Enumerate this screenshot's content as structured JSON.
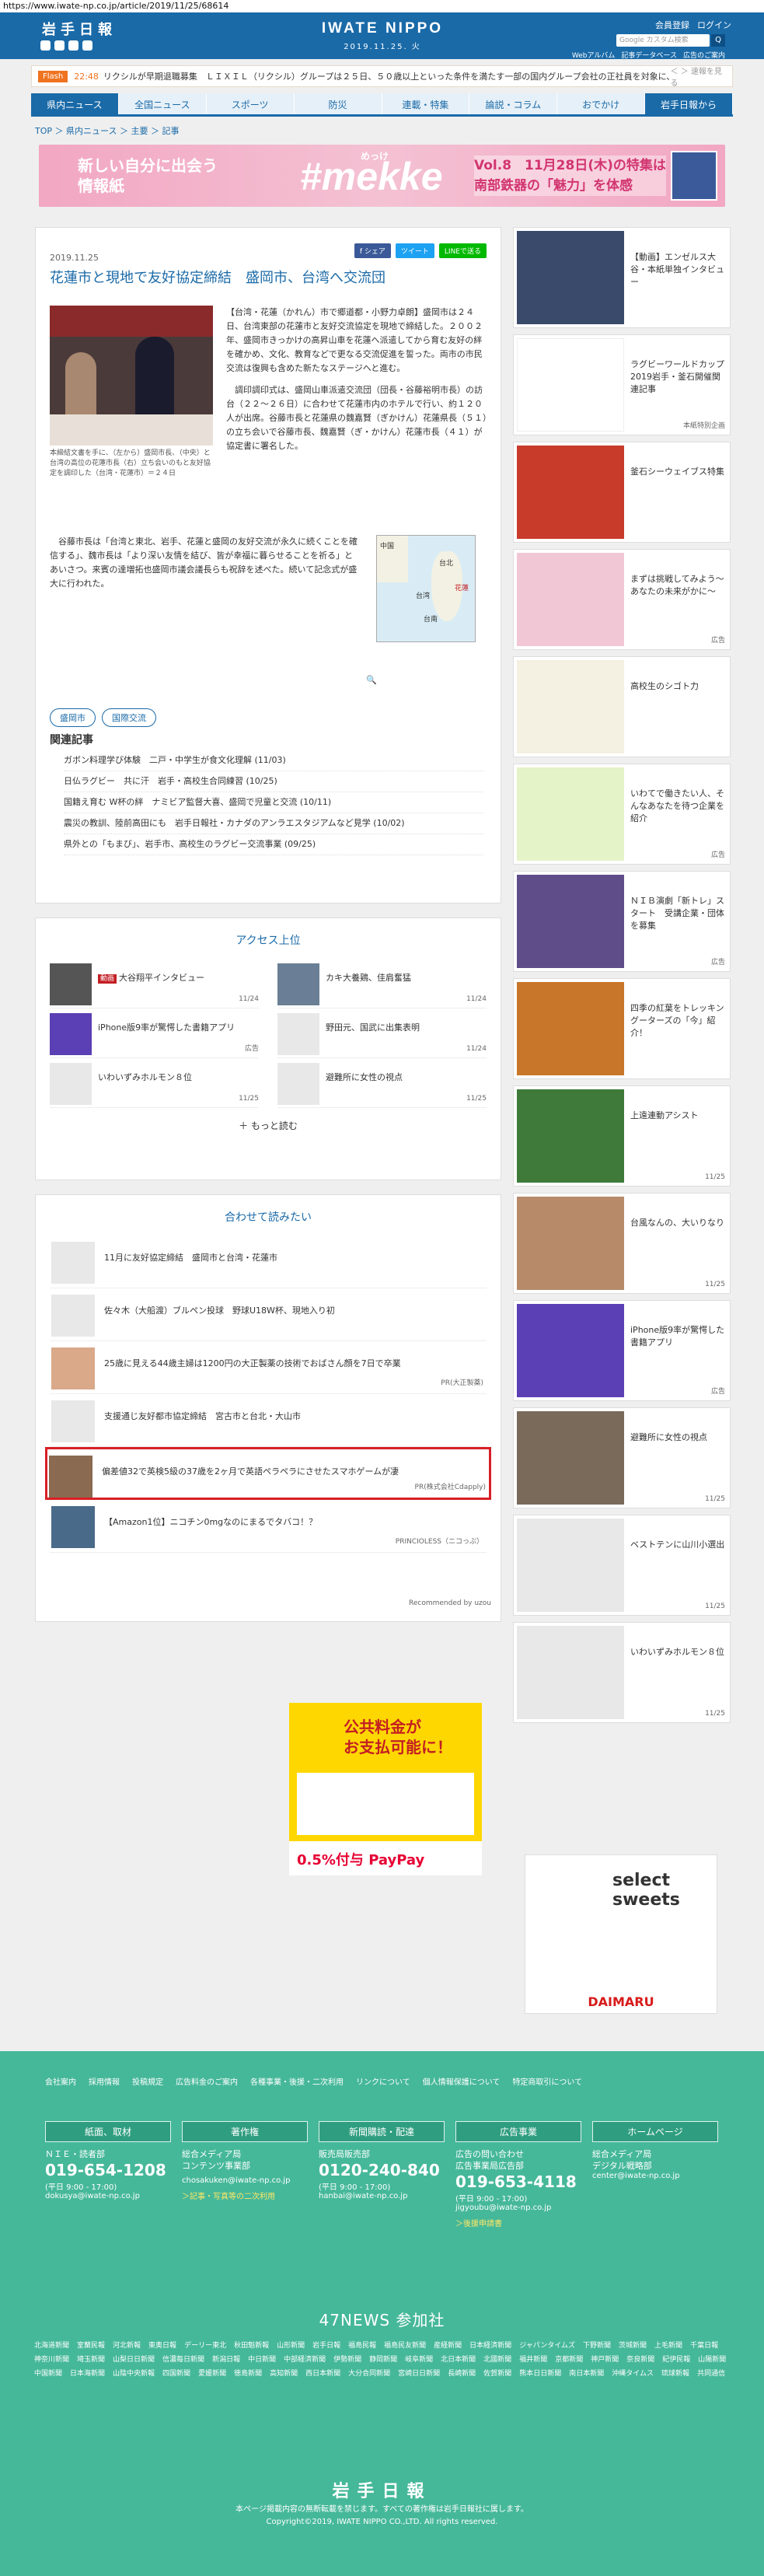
{
  "url": "https://www.iwate-np.co.jp/article/2019/11/25/68614",
  "header": {
    "logo": "岩手日報",
    "brand": "IWATE NIPPO",
    "date": "2019.11.25. 火",
    "member_register": "会員登録",
    "login": "ログイン",
    "search_placeholder": "Google カスタム検索",
    "search_btn": "Q",
    "links": [
      "Webアルバム",
      "記事データベース",
      "広告のご案内"
    ]
  },
  "flash": {
    "tag": "Flash",
    "time": "22:48",
    "text": "リクシルが早期退職募集　ＬＩＸＩＬ（リクシル）グループは２５日、５０歳以上といった条件を満たす一部の国内グループ会社の正社員を対象に、早期退職",
    "ctrl": "＜ ＞ 速報を見る"
  },
  "nav": [
    "県内ニュース",
    "全国ニュース",
    "スポーツ",
    "防災",
    "連載・特集",
    "論説・コラム",
    "おでかけ",
    "岩手日報から"
  ],
  "breadcrumb": "TOP ＞ 県内ニュース ＞ 主要 ＞ 記事",
  "banner": {
    "line1": "新しい自分に出会う",
    "line2": "情報紙",
    "mark": "#mekke",
    "mark_ruby": "めっけ",
    "vol": "Vol.8　11月28日(木)の特集は",
    "feature": "南部鉄器の「魅力」を体感"
  },
  "article": {
    "date": "2019.11.25",
    "title": "花蓮市と現地で友好協定締結　盛岡市、台湾へ交流団",
    "shares": [
      "f シェア",
      "ツイート",
      "LINEで送る"
    ],
    "caption": "本締結文書を手に、（左から）盛岡市長、（中央）と台湾の高位の花蓮市長（右）立ち会いのもと友好協定を調印した（台湾・花蓮市）＝２４日",
    "body1": "【台湾・花蓮（かれん）市で郷道都・小野力卓朗】盛岡市は２４日、台湾東部の花蓮市と友好交流協定を現地で締結した。２００２年、盛岡市きっかけの高昇山車を花蓮へ派遣してから育む友好の絆を確かめ、文化、教育などで更なる交流促進を誓った。両市の市民交流は復興も含めた新たなステージへと進む。",
    "body1b": "　調印調印式は、盛岡山車派遣交流団（団長・谷藤裕明市長）の訪台（２２～２６日）に合わせて花蓮市内のホテルで行い、約１２０人が出席。谷藤市長と花蓮県の魏嘉賢（ぎかけん）花蓮県長（５１）の立ち会いで谷藤市長、魏嘉賢（ぎ・かけん）花蓮市長（４１）が協定書に署名した。",
    "body2": "　谷藤市長は「台湾と東北、岩手、花蓮と盛岡の友好交流が永久に続くことを確信する」、魏市長は「より深い友情を結び、皆が幸福に暮らせることを祈る」とあいさつ。来賓の達増拓也盛岡市議会議長らも祝辞を述べた。続いて記念式が盛大に行われた。",
    "map_labels": [
      "中国",
      "台湾",
      "台北",
      "花蓮",
      "台南"
    ],
    "zoom_icon": "🔍",
    "tags": [
      "盛岡市",
      "国際交流"
    ],
    "related_heading": "関連記事",
    "related": [
      "ガボン料理学び体験　二戸・中学生が食文化理解 (11/03)",
      "日仏ラグビー　共に汗　岩手・高校生合同練習 (10/25)",
      "国籍え育む W杯の絆　ナミビア監督大喜、盛岡で児童と交流 (10/11)",
      "震災の教訓、陸前高田にも　岩手日報社・カナダのアンラエスタジアムなど見学 (10/02)",
      "県外との「もまび」、岩手市、高校生のラグビー交流事業 (09/25)"
    ]
  },
  "access": {
    "heading": "アクセス上位",
    "items": [
      {
        "badge": "動画",
        "text": "大谷翔平インタビュー",
        "date": "11/24"
      },
      {
        "text": "カキ大養鶏、佳肩奮猛",
        "date": "11/24"
      },
      {
        "text": "iPhone版9率が驚愕した書籍アプリ",
        "date": "広告"
      },
      {
        "text": "野田元、国武に出集表明",
        "date": "11/24"
      },
      {
        "text": "いわいずみホルモン８位",
        "date": "11/25"
      },
      {
        "text": "避難所に女性の視点",
        "date": "11/25"
      }
    ],
    "more": "＋ もっと読む"
  },
  "read": {
    "heading": "合わせて読みたい",
    "items": [
      {
        "text": "11月に友好協定締結　盛岡市と台湾・花蓮市",
        "pr": ""
      },
      {
        "text": "佐々木（大船渡）ブルペン投球　野球U18W杯、現地入り初",
        "pr": ""
      },
      {
        "text": "25歳に見える44歳主婦は1200円の大正製薬の技術でおばさん顔を7日で卒業",
        "pr": "PR(大正製薬)"
      },
      {
        "text": "支援通じ友好都市協定締結　宮古市と台北・大山市",
        "pr": ""
      },
      {
        "text": "偏差値32で英検5級の37歳を2ヶ月で英語ペラペラにさせたスマホゲームが凄",
        "pr": "PR(株式会社Cdapply)"
      },
      {
        "text": "【Amazon1位】ニコチン0mgなのにまるでタバコ！？",
        "pr": "PRINCIOLESS（ニコっぷ）"
      }
    ],
    "recommended": "Recommended by uzou"
  },
  "sidebar": [
    {
      "text": "【動画】エンゼルス大谷・本紙単独インタビュー",
      "date": ""
    },
    {
      "text": "ラグビーワールドカップ2019岩手・釜石開催関連記事",
      "date": "本紙特別企画"
    },
    {
      "text": "釜石シーウェイブス特集",
      "date": ""
    },
    {
      "text": "まずは挑戦してみよう～あなたの未来がかに～",
      "date": "広告"
    },
    {
      "text": "高校生のシゴト力",
      "date": ""
    },
    {
      "text": "いわてで働きたい人、そんなあなたを待つ企業を紹介",
      "date": "広告"
    },
    {
      "text": "ＮＩＢ演劇「新トレ」スタート　受講企業・団体を募集",
      "date": "広告"
    },
    {
      "text": "四季の紅葉をトレッキングーターズの「今」紹介！",
      "date": ""
    },
    {
      "text": "上遠連動アシスト",
      "date": "11/25"
    },
    {
      "text": "台風なんの、大いりなり",
      "date": "11/25"
    },
    {
      "text": "iPhone版9率が驚愕した書籍アプリ",
      "date": "広告"
    },
    {
      "text": "避難所に女性の視点",
      "date": "11/25"
    },
    {
      "text": "ベストテンに山川小選出",
      "date": "11/25"
    },
    {
      "text": "いわいずみホルモン８位",
      "date": "11/25"
    }
  ],
  "ads": {
    "ad1_head": "公共料金が\nお支払可能に！",
    "ad1_pay": "0.5%付与 PayPay",
    "ad2_title": "select sweets",
    "ad2_brand": "DAIMARU"
  },
  "footer": {
    "links": [
      "会社案内",
      "採用情報",
      "投稿規定",
      "広告料金のご案内",
      "各種事業・後援・二次利用",
      "リンクについて",
      "個人情報保護について",
      "特定商取引について"
    ],
    "boxes": [
      {
        "title": "紙面、取材",
        "label": "ＮＩＥ・読者部",
        "tel": "019-654-1208",
        "hours": "(平日 9:00 - 17:00)",
        "mail": "dokusya@iwate-np.co.jp",
        "extra": ""
      },
      {
        "title": "著作権",
        "label": "総合メディア局\nコンテンツ事業部",
        "tel": "",
        "hours": "",
        "mail": "chosakuken@iwate-np.co.jp",
        "extra": "＞記事・写真等の二次利用"
      },
      {
        "title": "新聞購読・配達",
        "label": "販売局販売部",
        "tel": "0120-240-840",
        "hours": "(平日 9:00 - 17:00)",
        "mail": "hanbai@iwate-np.co.jp",
        "extra": ""
      },
      {
        "title": "広告事業",
        "label": "広告の問い合わせ\n広告事業局広告部",
        "tel": "019-653-4118",
        "hours": "(平日 9:00 - 17:00)",
        "mail": "jigyoubu@iwate-np.co.jp",
        "extra": "＞後援申請書"
      },
      {
        "title": "ホームページ",
        "label": "総合メディア局\nデジタル戦略部",
        "tel": "",
        "hours": "",
        "mail": "center@iwate-np.co.jp",
        "extra": ""
      }
    ],
    "n47_title": "47NEWS 参加社",
    "n47": [
      "北海道新聞",
      "室蘭民報",
      "河北新報",
      "東奥日報",
      "デーリー東北",
      "秋田魁新報",
      "山形新聞",
      "岩手日報",
      "福島民報",
      "福島民友新聞",
      "産経新聞",
      "日本経済新聞",
      "ジャパンタイムズ",
      "下野新聞",
      "茨城新聞",
      "上毛新聞",
      "千葉日報",
      "神奈川新聞",
      "埼玉新聞",
      "山梨日日新聞",
      "信濃毎日新聞",
      "新潟日報",
      "中日新聞",
      "中部経済新聞",
      "伊勢新聞",
      "静岡新聞",
      "岐阜新聞",
      "北日本新聞",
      "北國新聞",
      "福井新聞",
      "京都新聞",
      "神戸新聞",
      "奈良新聞",
      "紀伊民報",
      "山陽新聞",
      "中国新聞",
      "日本海新聞",
      "山陰中央新報",
      "四国新聞",
      "愛媛新聞",
      "徳島新聞",
      "高知新聞",
      "西日本新聞",
      "大分合同新聞",
      "宮崎日日新聞",
      "長崎新聞",
      "佐賀新聞",
      "熊本日日新聞",
      "南日本新聞",
      "沖縄タイムス",
      "琉球新報",
      "共同通信"
    ],
    "logo": "岩手日報",
    "copy1": "本ページ掲載内容の無断転載を禁じます。すべての著作権は岩手日報社に属します。",
    "copy2": "Copyright©2019, IWATE NIPPO CO.,LTD. All rights reserved."
  }
}
